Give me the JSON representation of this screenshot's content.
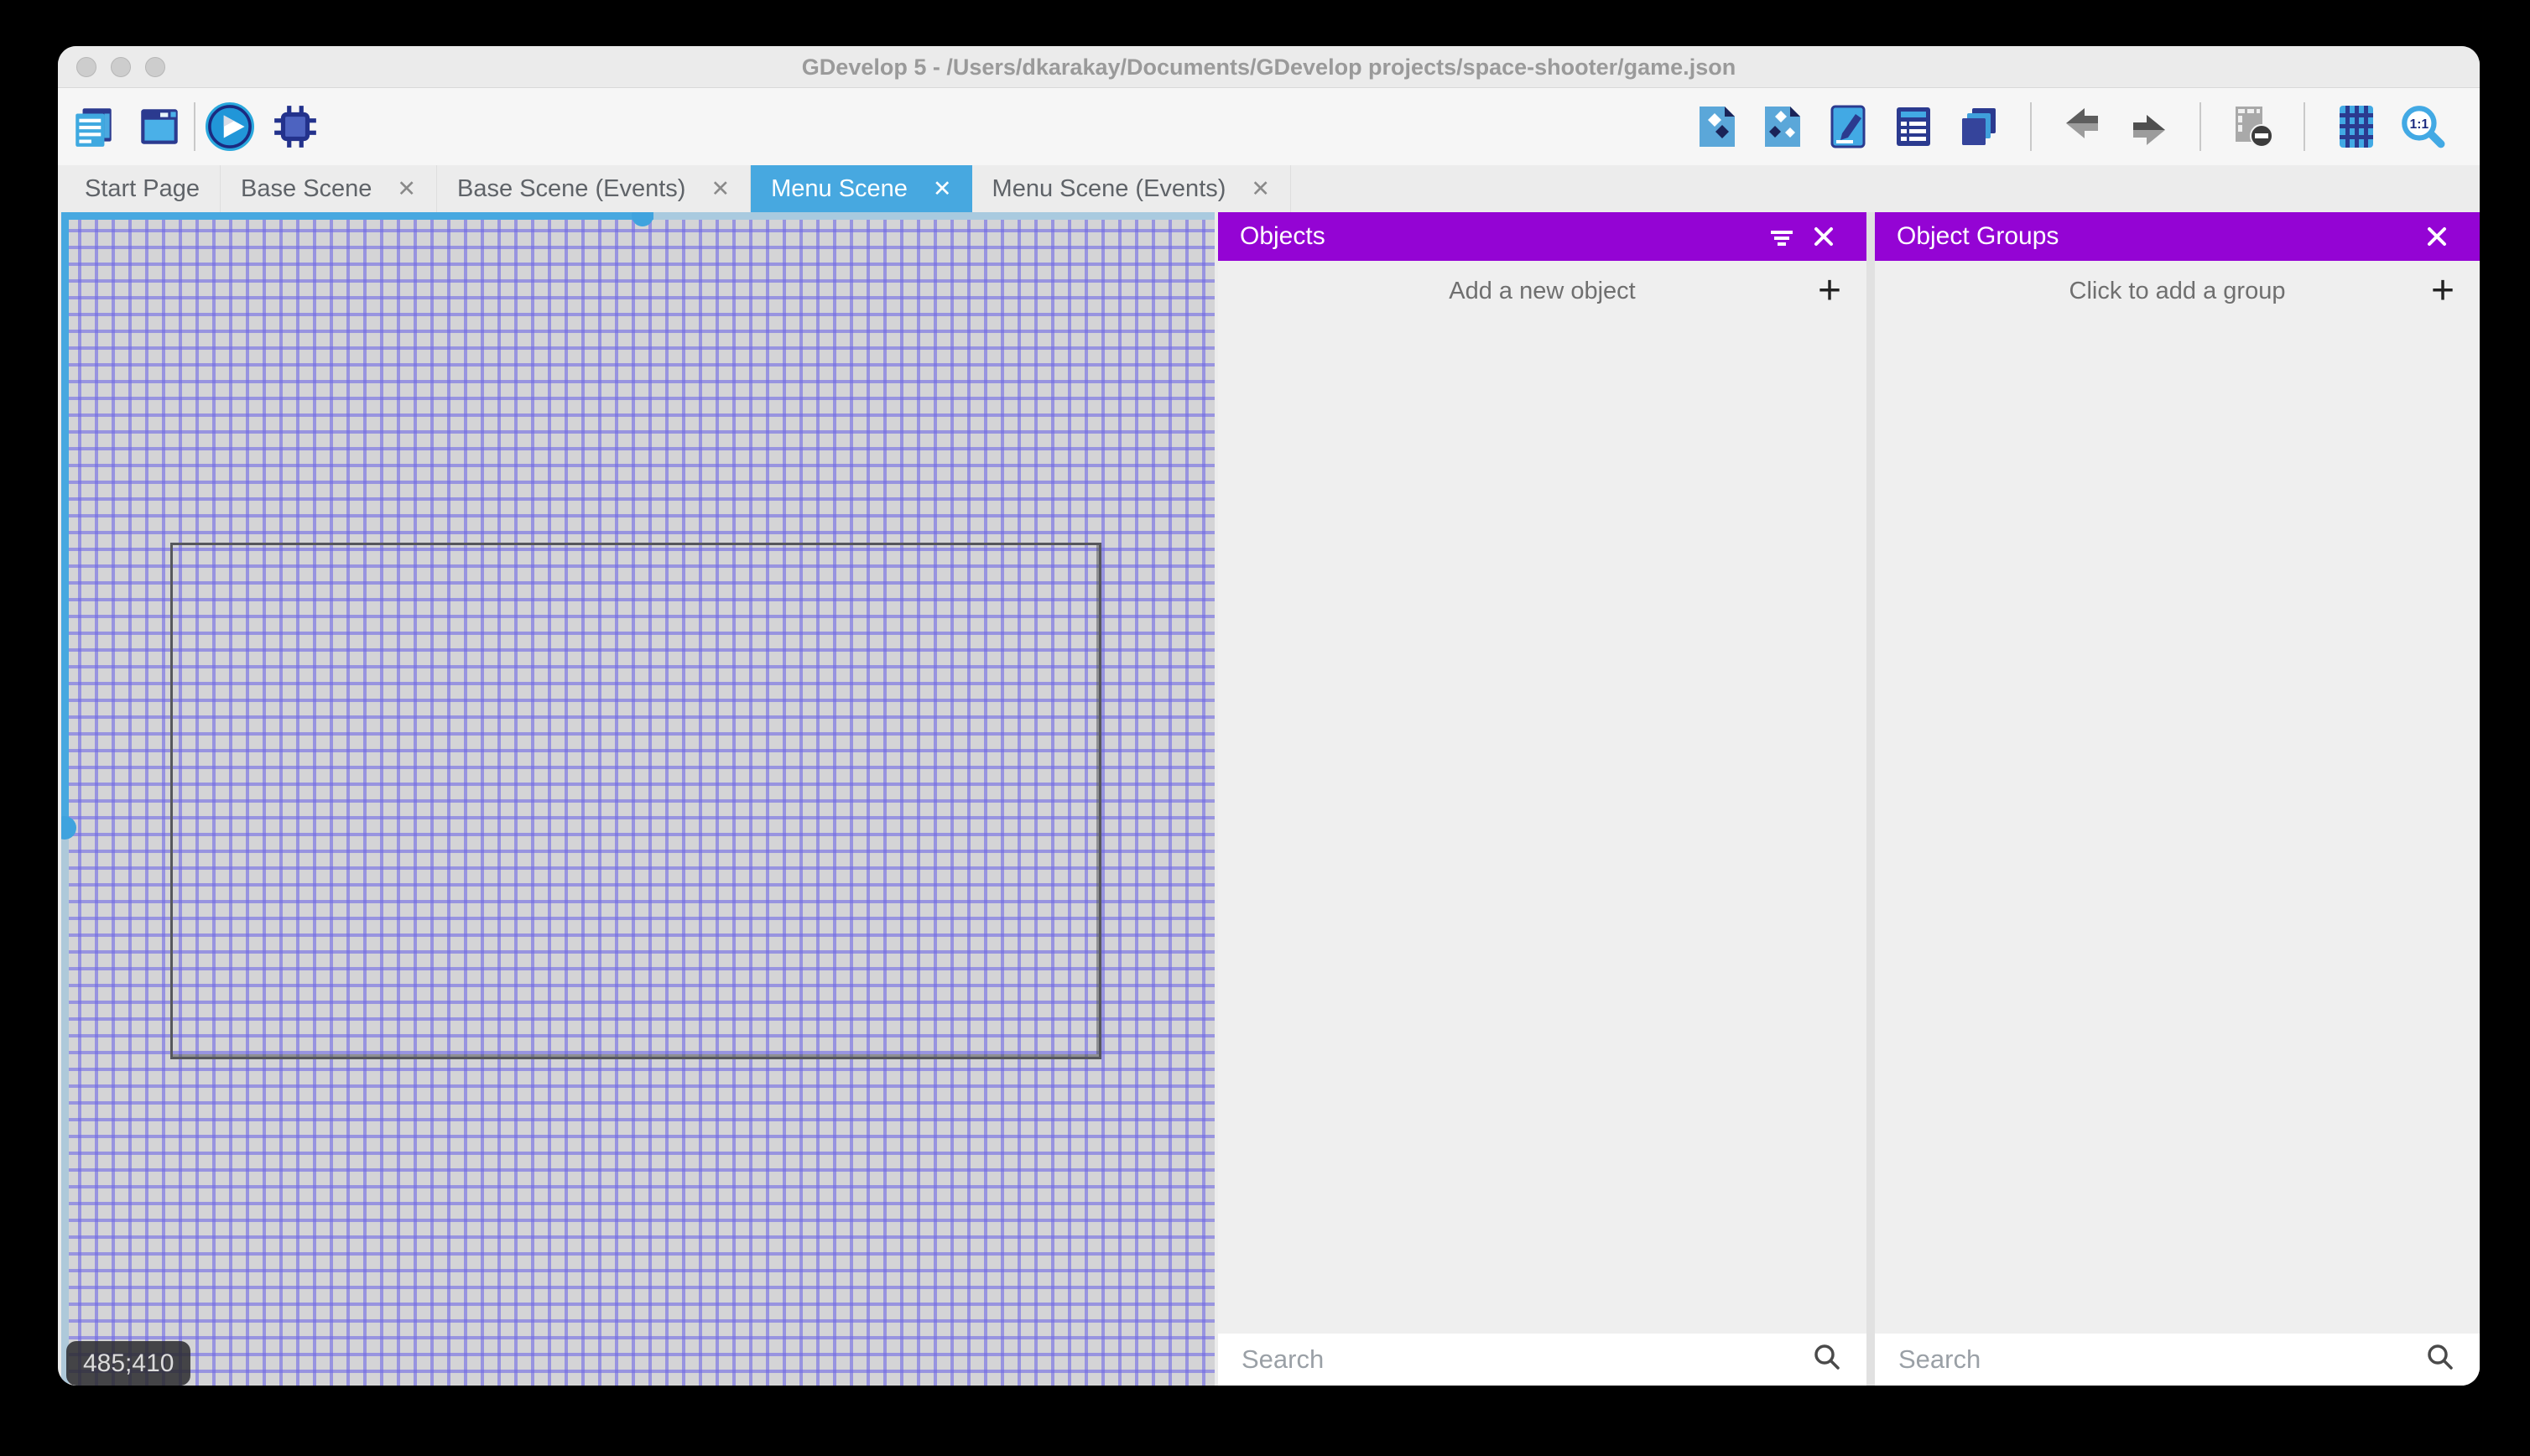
{
  "window": {
    "title": "GDevelop 5 - /Users/dkarakay/Documents/GDevelop projects/space-shooter/game.json"
  },
  "toolbar": {
    "left_icons": [
      "project-manager",
      "start-page",
      "preview-play",
      "debug"
    ],
    "right_icons": [
      "objects-panel",
      "object-groups-panel",
      "properties-panel",
      "instances-list",
      "layers-panel",
      "undo",
      "redo",
      "delete-instances",
      "grid",
      "zoom-reset"
    ],
    "zoom_icon_label": "1:1"
  },
  "tabs": [
    {
      "label": "Start Page",
      "closable": false,
      "active": false
    },
    {
      "label": "Base Scene",
      "closable": true,
      "active": false
    },
    {
      "label": "Base Scene (Events)",
      "closable": true,
      "active": false
    },
    {
      "label": "Menu Scene",
      "closable": true,
      "active": true
    },
    {
      "label": "Menu Scene (Events)",
      "closable": true,
      "active": false
    }
  ],
  "canvas": {
    "coordinate_label": "485;410"
  },
  "objects_panel": {
    "title": "Objects",
    "add_label": "Add a new object",
    "search_placeholder": "Search"
  },
  "object_groups_panel": {
    "title": "Object Groups",
    "add_label": "Click to add a group",
    "search_placeholder": "Search"
  },
  "ui": {
    "close_glyph": "✕",
    "add_glyph": "+"
  },
  "colors": {
    "panel_header_purple": "#9404d4",
    "active_tab_blue": "#47a8e0",
    "selection_blue": "#47a8e0",
    "grid_line": "#6f69e5",
    "canvas_background": "#d4d4d6"
  }
}
